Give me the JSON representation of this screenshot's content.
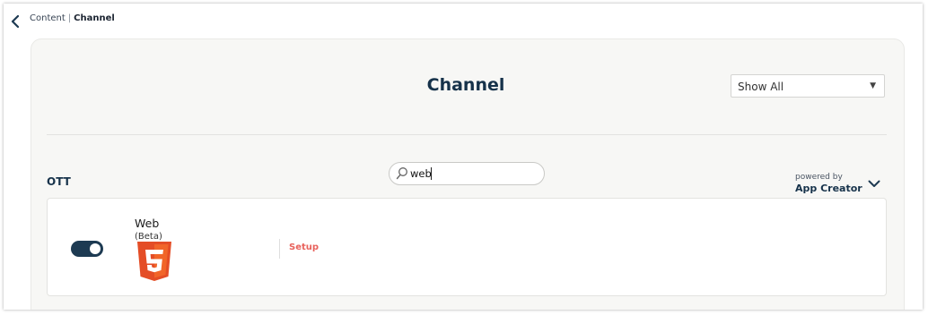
{
  "breadcrumb": {
    "parent": "Content",
    "separator": "|",
    "current": "Channel"
  },
  "page": {
    "title": "Channel"
  },
  "filter": {
    "selected": "Show All",
    "caret": "▼"
  },
  "section": {
    "title": "OTT",
    "search_value": "web",
    "powered_by_label": "powered by",
    "powered_by_brand": "App Creator"
  },
  "channels": [
    {
      "name": "Web",
      "tag": "(Beta)",
      "icon": "html5-icon",
      "enabled": true,
      "action_label": "Setup"
    }
  ],
  "colors": {
    "accent": "#e8625c",
    "toggle_on": "#1d3a52",
    "title": "#16324a",
    "html5_orange": "#e44d26"
  }
}
